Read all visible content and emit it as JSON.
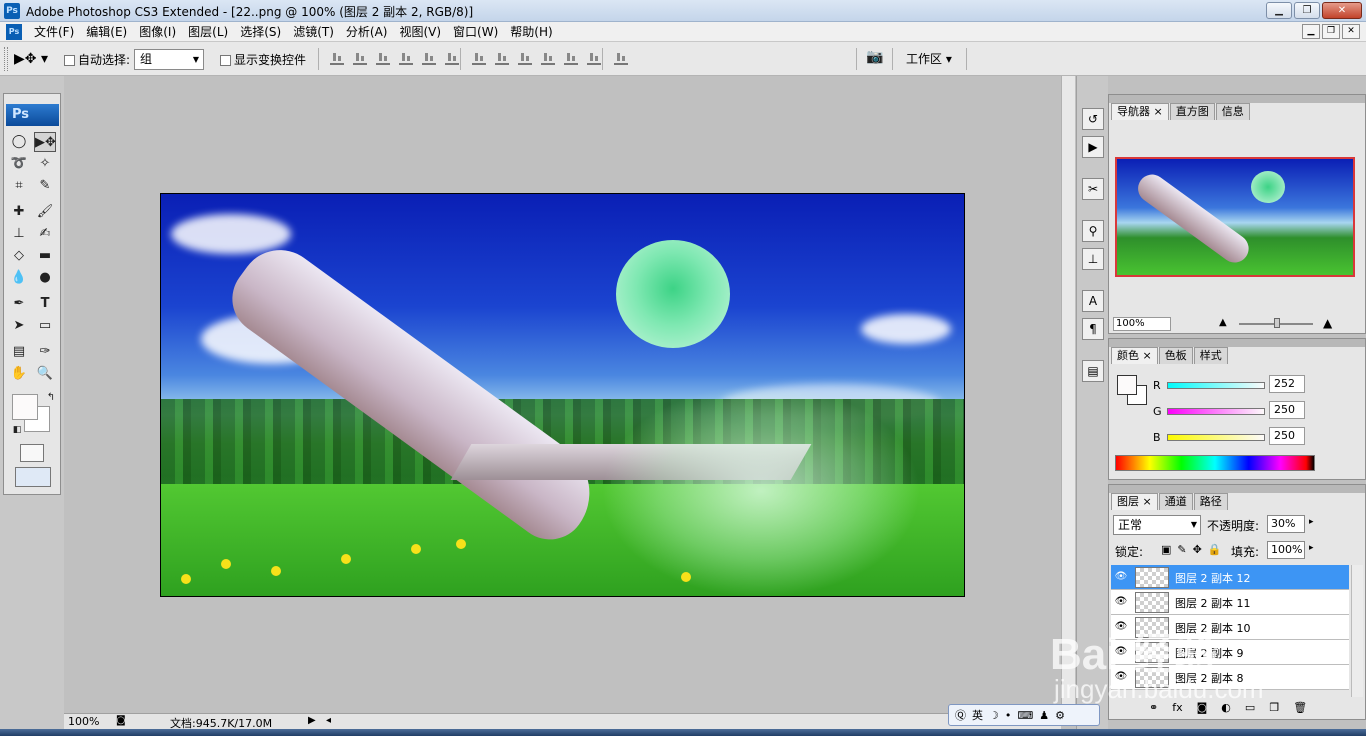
{
  "window": {
    "title": "Adobe Photoshop CS3 Extended - [22..png @ 100% (图层 2 副本 2, RGB/8)]",
    "app_icon": "Ps"
  },
  "menu": [
    "文件(F)",
    "编辑(E)",
    "图像(I)",
    "图层(L)",
    "选择(S)",
    "滤镜(T)",
    "分析(A)",
    "视图(V)",
    "窗口(W)",
    "帮助(H)"
  ],
  "options": {
    "auto_select_label": "自动选择:",
    "auto_select_value": "组",
    "show_transform_label": "显示变换控件",
    "workspace_label": "工作区 ▾"
  },
  "toolbox": {
    "header": "Ps",
    "foreground_color": "#fcfafa",
    "background_color": "#ffffff"
  },
  "status": {
    "zoom": "100%",
    "doc_size": "文档:945.7K/17.0M"
  },
  "navigator": {
    "tabs": [
      "导航器 ×",
      "直方图",
      "信息"
    ],
    "zoom": "100%"
  },
  "color_panel": {
    "tabs": [
      "颜色 ×",
      "色板",
      "样式"
    ],
    "channels": [
      {
        "name": "R",
        "value": "252",
        "gradient": "linear-gradient(90deg,#00fafa,#fcfafa)"
      },
      {
        "name": "G",
        "value": "250",
        "gradient": "linear-gradient(90deg,#fc00fa,#fcfafa)"
      },
      {
        "name": "B",
        "value": "250",
        "gradient": "linear-gradient(90deg,#fcfa00,#fcfafa)"
      }
    ]
  },
  "layers_panel": {
    "tabs": [
      "图层 ×",
      "通道",
      "路径"
    ],
    "blend_mode": "正常",
    "opacity_label": "不透明度:",
    "opacity": "30%",
    "lock_label": "锁定:",
    "fill_label": "填充:",
    "fill": "100%",
    "layers": [
      {
        "name": "图层 2 副本 12",
        "selected": true
      },
      {
        "name": "图层 2 副本 11",
        "selected": false
      },
      {
        "name": "图层 2 副本 10",
        "selected": false
      },
      {
        "name": "图层 2 副本 9",
        "selected": false
      },
      {
        "name": "图层 2 副本 8",
        "selected": false
      }
    ]
  },
  "ime": {
    "lang": "英"
  },
  "watermark": {
    "brand": "Bai 经验",
    "url": "jingyan.baidu.com"
  }
}
